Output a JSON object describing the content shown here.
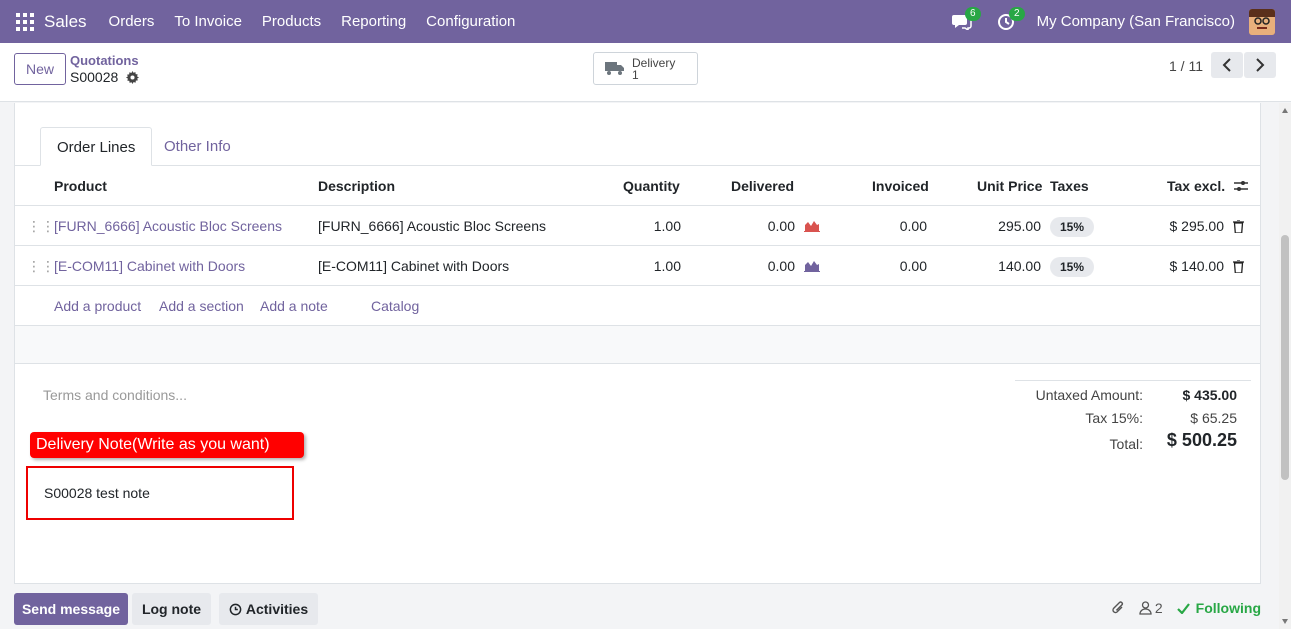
{
  "navbar": {
    "brand": "Sales",
    "menu": [
      "Orders",
      "To Invoice",
      "Products",
      "Reporting",
      "Configuration"
    ],
    "messages_count": "6",
    "activities_count": "2",
    "company": "My Company (San Francisco)"
  },
  "control": {
    "new_label": "New",
    "breadcrumb": "Quotations",
    "record_name": "S00028",
    "smart_button": {
      "label": "Delivery",
      "count": "1"
    },
    "pager": "1 / 11"
  },
  "tabs": [
    "Order Lines",
    "Other Info"
  ],
  "table": {
    "headers": [
      "Product",
      "Description",
      "Quantity",
      "Delivered",
      "Invoiced",
      "Unit Price",
      "Taxes",
      "Tax excl."
    ],
    "rows": [
      {
        "product": "[FURN_6666] Acoustic Bloc Screens",
        "description": "[FURN_6666] Acoustic Bloc Screens",
        "quantity": "1.00",
        "delivered": "0.00",
        "invoiced": "0.00",
        "unit_price": "295.00",
        "taxes": "15%",
        "tax_excl": "$ 295.00",
        "forecast_color": "#d9534f"
      },
      {
        "product": "[E-COM11] Cabinet with Doors",
        "description": "[E-COM11] Cabinet with Doors",
        "quantity": "1.00",
        "delivered": "0.00",
        "invoiced": "0.00",
        "unit_price": "140.00",
        "taxes": "15%",
        "tax_excl": "$ 140.00",
        "forecast_color": "#71639e"
      }
    ],
    "add_links": [
      "Add a product",
      "Add a section",
      "Add a note",
      "Catalog"
    ]
  },
  "terms_placeholder": "Terms and conditions...",
  "annotation": "Delivery Note(Write as you want)",
  "note_text": "S00028 test note",
  "totals": {
    "untaxed_label": "Untaxed Amount:",
    "untaxed_value": "$ 435.00",
    "tax_label": "Tax 15%:",
    "tax_value": "$ 65.25",
    "total_label": "Total:",
    "total_value": "$ 500.25"
  },
  "chatter": {
    "send_message": "Send message",
    "log_note": "Log note",
    "activities": "Activities",
    "followers_count": "2",
    "following": "Following"
  }
}
